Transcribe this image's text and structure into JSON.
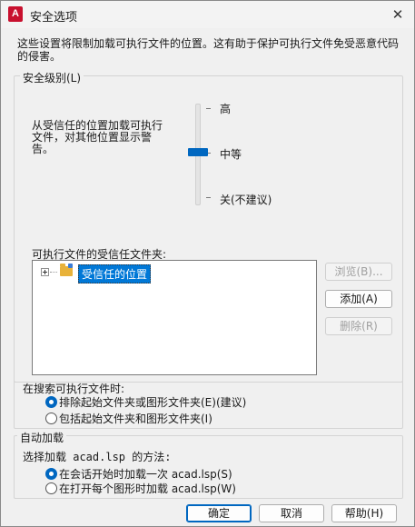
{
  "window": {
    "title": "安全选项",
    "app_icon_letter": "A"
  },
  "description": "这些设置将限制加载可执行文件的位置。这有助于保护可执行文件免受恶意代码的侵害。",
  "security_level": {
    "legend": "安全级别(L)",
    "explanation": "从受信任的位置加载可执行文件，对其他位置显示警告。",
    "levels": [
      "高",
      "中等",
      "关(不建议)"
    ],
    "selected": "中等"
  },
  "trusted_folders": {
    "label": "可执行文件的受信任文件夹:",
    "nodes": [
      {
        "label": "受信任的位置",
        "selected": true
      }
    ]
  },
  "side_buttons": {
    "browse": "浏览(B)...",
    "add": "添加(A)",
    "delete": "删除(R)"
  },
  "search": {
    "legend": "在搜索可执行文件时:",
    "options": [
      {
        "label": "排除起始文件夹或图形文件夹(E)(建议)",
        "checked": true
      },
      {
        "label": "包括起始文件夹和图形文件夹(I)",
        "checked": false
      }
    ]
  },
  "autoload": {
    "legend": "自动加载",
    "method_label": "选择加载 acad.lsp 的方法:",
    "options": [
      {
        "label": "在会话开始时加载一次 acad.lsp(S)",
        "checked": true
      },
      {
        "label": "在打开每个图形时加载 acad.lsp(W)",
        "checked": false
      }
    ]
  },
  "footer": {
    "ok": "确定",
    "cancel": "取消",
    "help": "帮助(H)"
  },
  "colors": {
    "accent": "#0067c0",
    "selection": "#0078d7",
    "app_icon": "#c8102e"
  }
}
